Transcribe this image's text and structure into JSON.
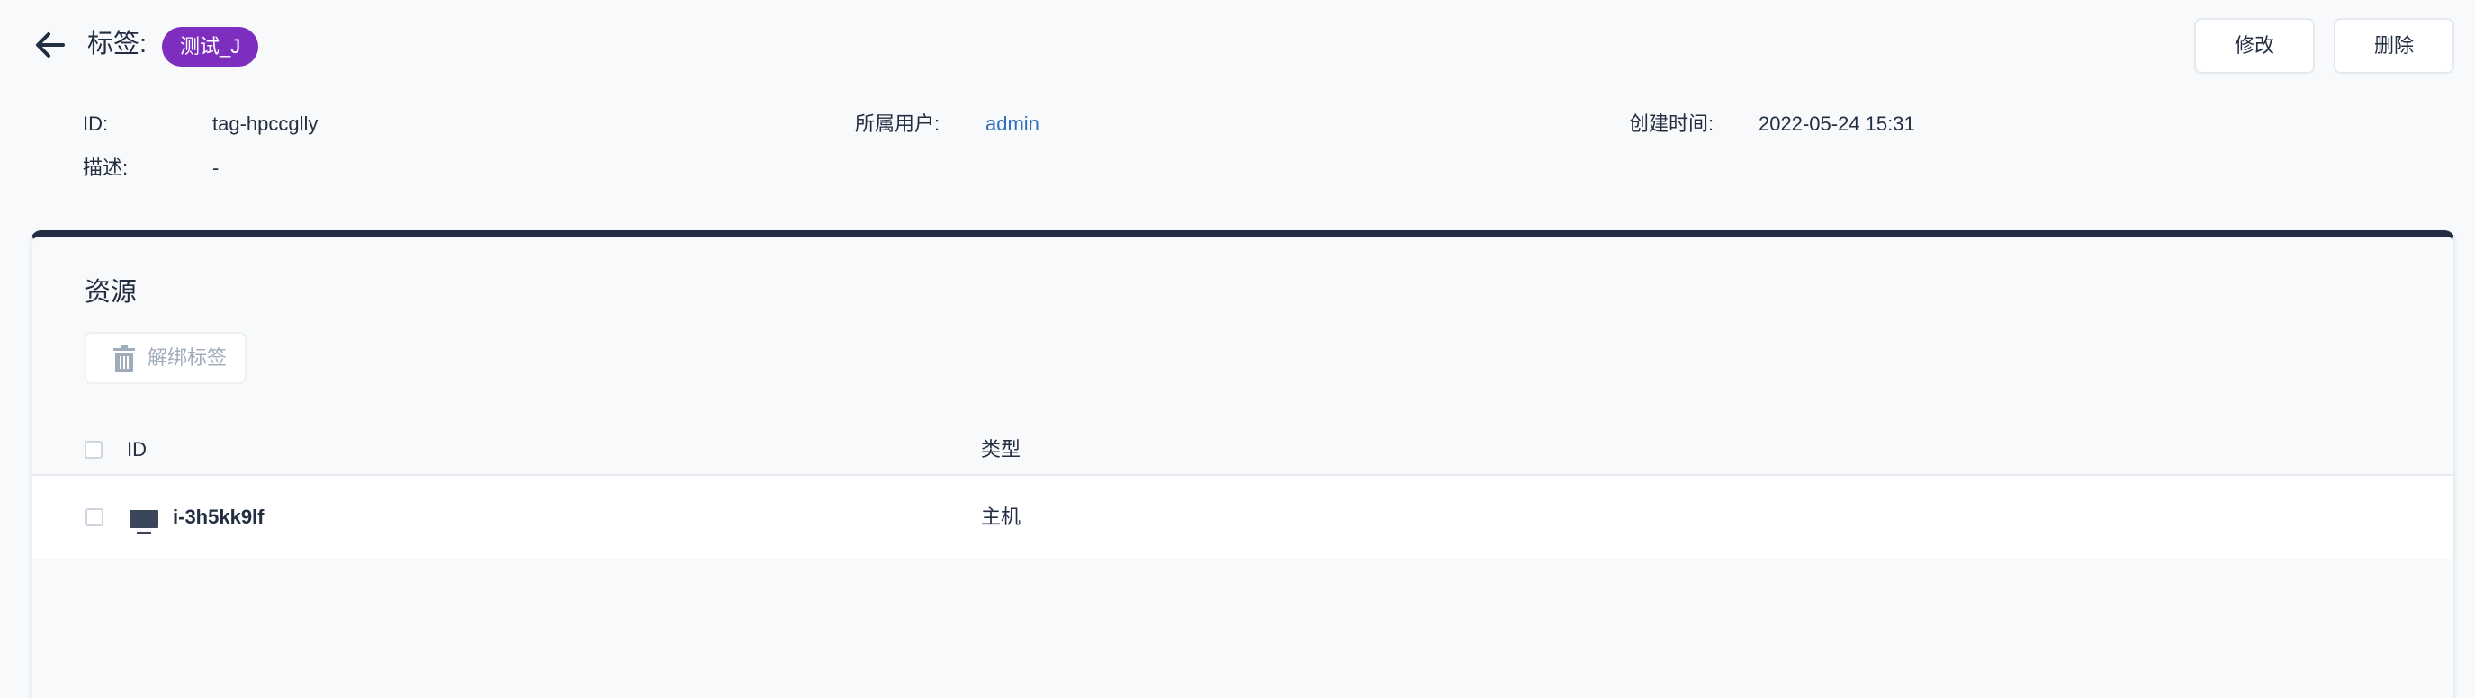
{
  "header": {
    "title": "标签:",
    "tag_name": "测试_J",
    "tag_color": "#7d2ebf",
    "edit_label": "修改",
    "delete_label": "删除"
  },
  "info": {
    "id_label": "ID:",
    "id_value": "tag-hpccglly",
    "owner_label": "所属用户:",
    "owner_value": "admin",
    "created_label": "创建时间:",
    "created_value": "2022-05-24 15:31",
    "desc_label": "描述:",
    "desc_value": "-"
  },
  "resources": {
    "title": "资源",
    "unbind_label": "解绑标签",
    "columns": [
      "ID",
      "类型"
    ],
    "rows": [
      {
        "id": "i-3h5kk9lf",
        "type": "主机",
        "icon": "host-icon"
      }
    ]
  },
  "colors": {
    "accent": "#242e42",
    "link": "#2f6fba",
    "badge": "#7d2ebf"
  }
}
